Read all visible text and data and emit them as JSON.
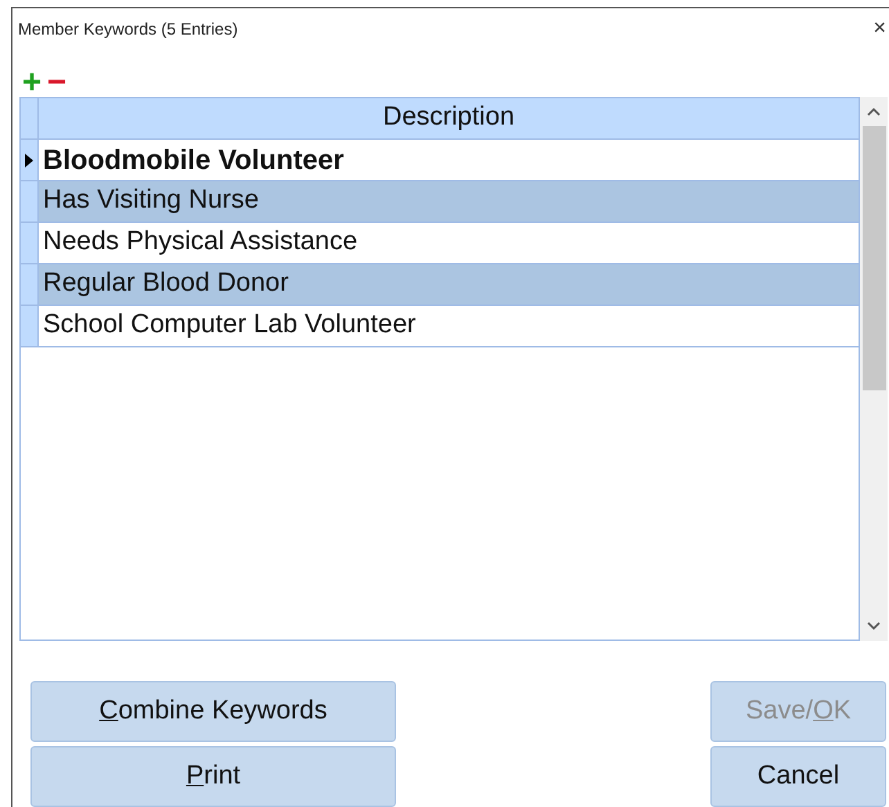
{
  "window": {
    "title": "Member Keywords (5 Entries)",
    "close_glyph": "×"
  },
  "toolbar": {
    "add_glyph": "+",
    "remove_glyph": "−"
  },
  "grid": {
    "columns": [
      "Description"
    ],
    "rows": [
      {
        "description": "Bloodmobile Volunteer",
        "current": true,
        "selected": false
      },
      {
        "description": "Has Visiting Nurse",
        "current": false,
        "selected": true
      },
      {
        "description": "Needs Physical Assistance",
        "current": false,
        "selected": false
      },
      {
        "description": "Regular Blood Donor",
        "current": false,
        "selected": true
      },
      {
        "description": "School Computer Lab Volunteer",
        "current": false,
        "selected": false
      }
    ]
  },
  "left_buttons": [
    {
      "underlined": "C",
      "after": "ombine Keywords",
      "disabled": false
    },
    {
      "underlined": "P",
      "after": "rint",
      "disabled": false
    }
  ],
  "right_buttons": [
    {
      "before": "Save/",
      "underlined": "O",
      "after": "K",
      "disabled": true
    },
    {
      "before": "Cancel",
      "disabled": false
    }
  ]
}
